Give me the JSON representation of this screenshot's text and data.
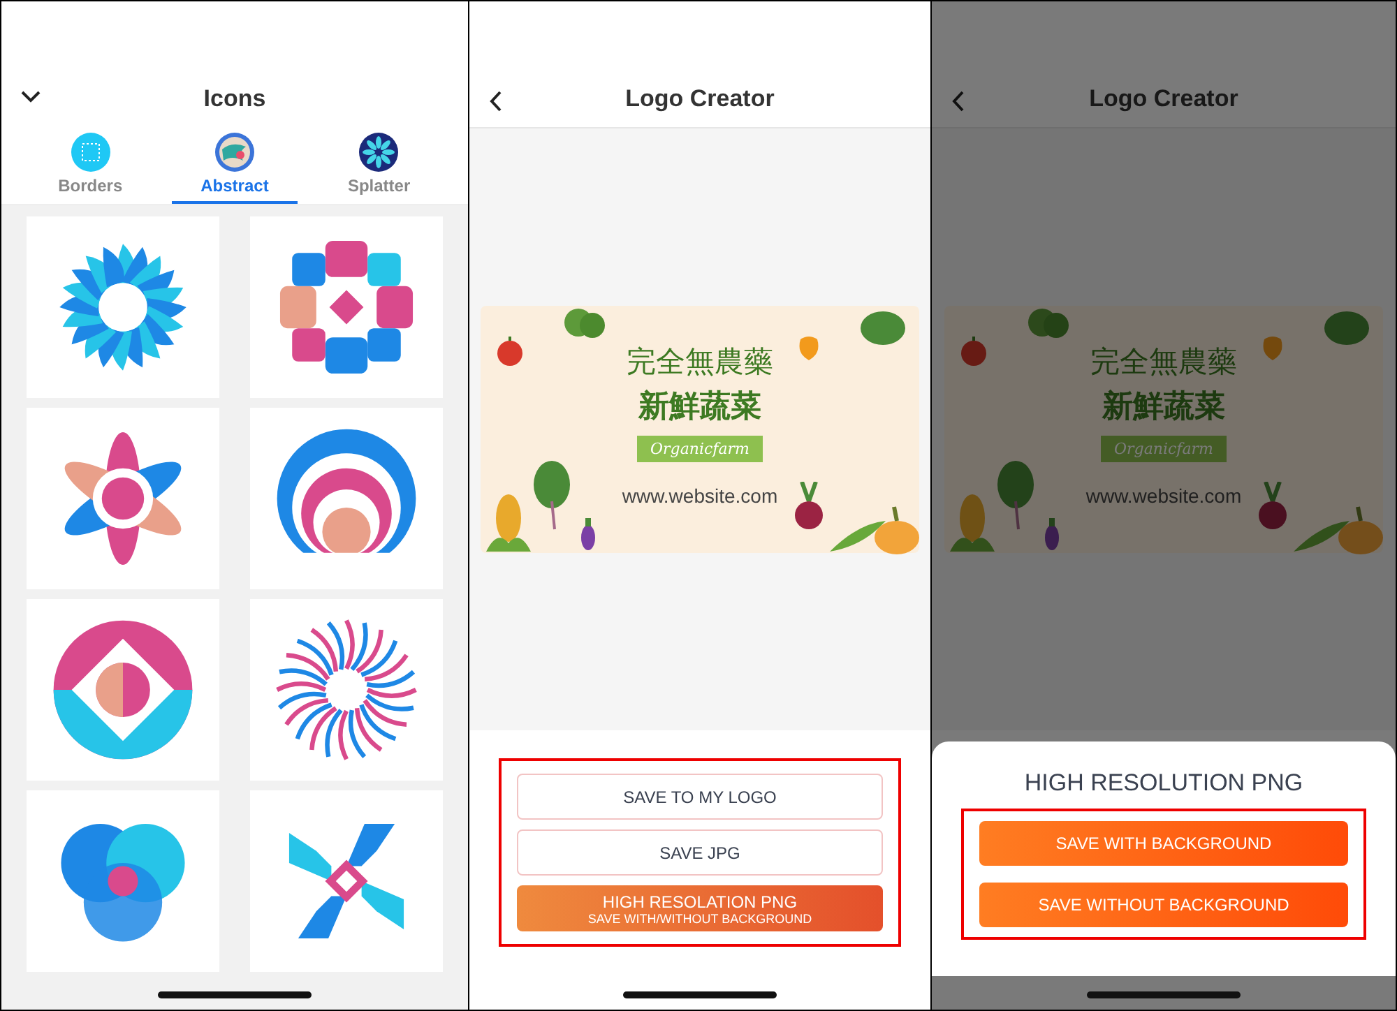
{
  "icons_panel": {
    "title": "Icons",
    "tabs": [
      {
        "label": "Borders",
        "selected": false,
        "kind": "borders"
      },
      {
        "label": "Abstract",
        "selected": true,
        "kind": "abstract"
      },
      {
        "label": "Splatter",
        "selected": false,
        "kind": "splatter"
      }
    ],
    "cards": [
      {
        "kind": "sunburst"
      },
      {
        "kind": "petal-diamond"
      },
      {
        "kind": "flower"
      },
      {
        "kind": "rings"
      },
      {
        "kind": "diamond-circle"
      },
      {
        "kind": "swirl"
      },
      {
        "kind": "trefoil"
      },
      {
        "kind": "pinwheel"
      }
    ]
  },
  "editor_panel": {
    "title": "Logo Creator",
    "logo": {
      "headline": "完全無農藥",
      "subhead": "新鮮蔬菜",
      "tag": "Organicfarm",
      "website": "www.website.com"
    },
    "buttons": [
      {
        "label": "SAVE TO MY LOGO",
        "kind": "outline"
      },
      {
        "label": "SAVE JPG",
        "kind": "outline"
      },
      {
        "label": "HIGH RESOLATION PNG",
        "sublabel": "SAVE WITH/WITHOUT BACKGROUND",
        "kind": "primary"
      }
    ]
  },
  "dialog_panel": {
    "title": "Logo Creator",
    "logo": {
      "headline": "完全無農藥",
      "subhead": "新鮮蔬菜",
      "tag": "Organicfarm",
      "website": "www.website.com"
    },
    "sheet": {
      "title": "HIGH RESOLUTION PNG",
      "buttons": [
        {
          "label": "SAVE WITH BACKGROUND"
        },
        {
          "label": "SAVE WITHOUT BACKGROUND"
        }
      ]
    }
  }
}
